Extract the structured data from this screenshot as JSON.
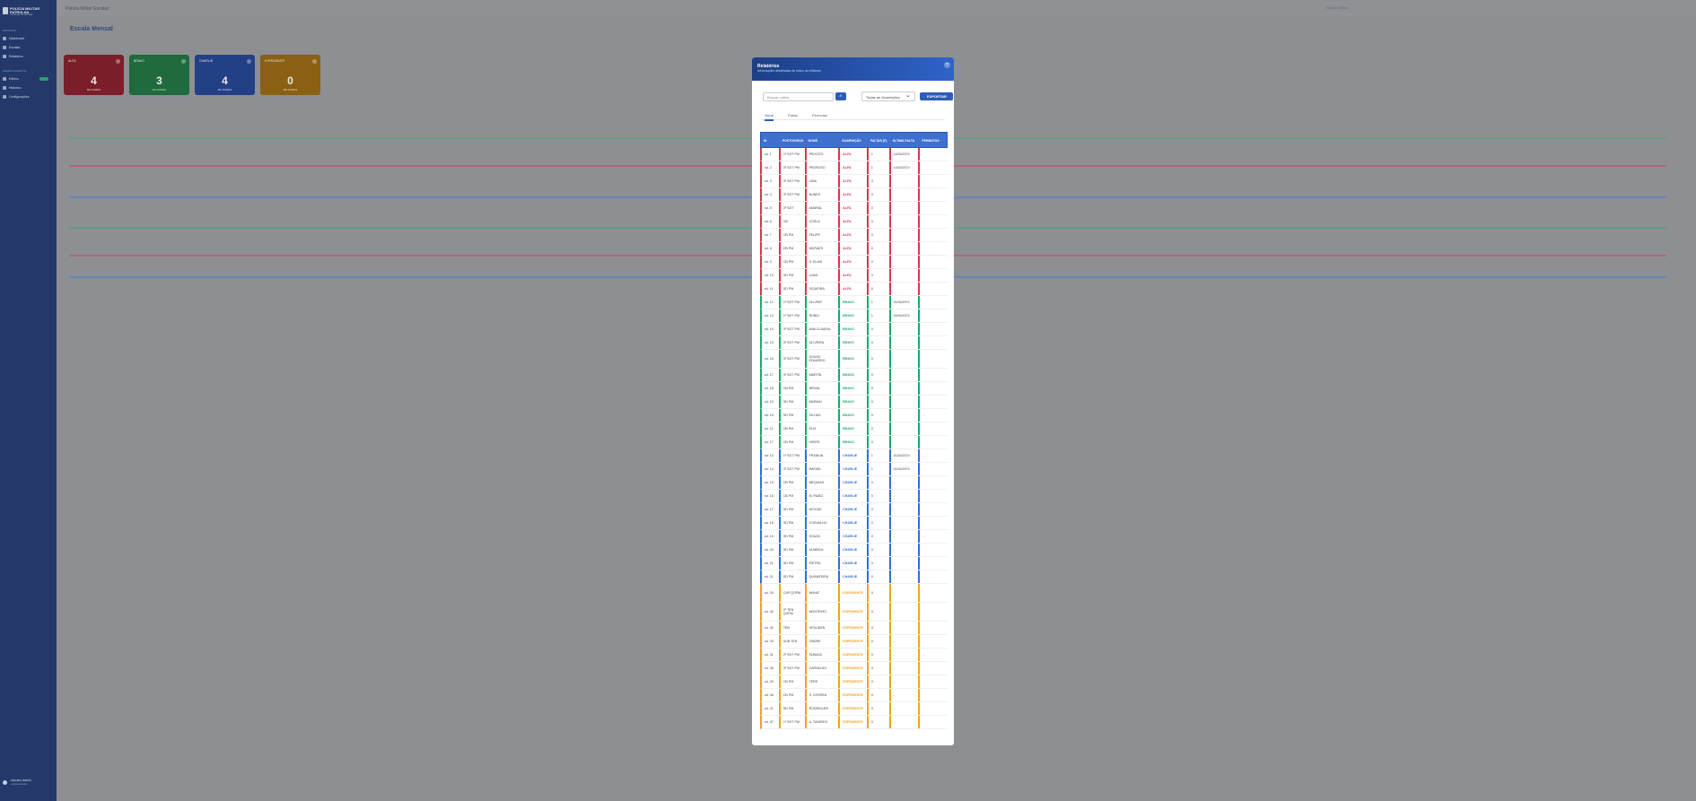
{
  "app": {
    "brand": "POLÍCIA MILITAR",
    "brand_line2": "PATRULHA",
    "subtitle": "Controle de Escala"
  },
  "sidebar": {
    "section_main": "PRINCIPAL",
    "section_cfg": "GERENCIAMENTO",
    "items": [
      {
        "label": "Dashboard"
      },
      {
        "label": "Escalas"
      },
      {
        "label": "Relatórios"
      },
      {
        "label": "Efetivo"
      },
      {
        "label": "Histórico"
      },
      {
        "label": "Configurações"
      }
    ],
    "user_name": "Usuário Admin",
    "user_role": "Administrador"
  },
  "topbar": {
    "title": "Polícia Militar Escalas",
    "search_placeholder": "Buscar militar..."
  },
  "page": {
    "title": "Escala Mensal"
  },
  "cards": [
    {
      "label": "ALFA",
      "value": "4",
      "sub": "MILITARES",
      "color": "#7a1f29"
    },
    {
      "label": "BRAVO",
      "value": "3",
      "sub": "MILITARES",
      "color": "#1f6b3e"
    },
    {
      "label": "CHARLIE",
      "value": "4",
      "sub": "MILITARES",
      "color": "#233f86"
    },
    {
      "label": "EXPEDIENTE",
      "value": "0",
      "sub": "MILITARES",
      "color": "#8a6012"
    }
  ],
  "calendar_lines": [
    "#c9495a",
    "#4c7bd0",
    "#46a873",
    "#c9495a",
    "#4c7bd0",
    "#46a873"
  ],
  "modal": {
    "title": "Relatórios",
    "subtitle": "Informações detalhadas de todos os militares",
    "close": "×",
    "search_placeholder": "Buscar militar...",
    "search_icon": "search-icon",
    "filter_value": "Todas as Guarnições",
    "export_label": "EXPORTAR",
    "tabs": [
      "Geral",
      "Faltas",
      "Permutas"
    ],
    "columns": [
      "ID",
      "POSTO/GRAD",
      "NOME",
      "GUARNIÇÃO",
      "FALTAS (F)",
      "ÚLTIMA FALTA",
      "PERMUTAS"
    ],
    "rows": [
      {
        "id": "sd. 1",
        "posto": "1º SGT PM",
        "nome": "PEIXOTO",
        "gu": "ALFA",
        "faltas": "1",
        "ultima": "14/04/2074",
        "perm": "",
        "g": "alfa"
      },
      {
        "id": "sd. 2",
        "posto": "3º SGT PM",
        "nome": "PEDROSO",
        "gu": "ALFA",
        "faltas": "1",
        "ultima": "14/04/2074",
        "perm": "",
        "g": "alfa"
      },
      {
        "id": "sd. 3",
        "posto": "3º SGT PM",
        "nome": "LIMA",
        "gu": "ALFA",
        "faltas": "0",
        "ultima": "",
        "perm": "",
        "g": "alfa"
      },
      {
        "id": "sd. 4",
        "posto": "3º SGT PM",
        "nome": "NUNES",
        "gu": "ALFA",
        "faltas": "0",
        "ultima": "",
        "perm": "",
        "g": "alfa"
      },
      {
        "id": "sd. 5",
        "posto": "3º SGT",
        "nome": "AMARAL",
        "gu": "ALFA",
        "faltas": "0",
        "ultima": "",
        "perm": "",
        "g": "alfa"
      },
      {
        "id": "sd. 6",
        "posto": "CB",
        "nome": "COELA",
        "gu": "ALFA",
        "faltas": "0",
        "ultima": "",
        "perm": "",
        "g": "alfa"
      },
      {
        "id": "sd. 7",
        "posto": "CB PM",
        "nome": "FELIPE",
        "gu": "ALFA",
        "faltas": "0",
        "ultima": "",
        "perm": "",
        "g": "alfa"
      },
      {
        "id": "sd. 8",
        "posto": "CB PM",
        "nome": "MORAES",
        "gu": "ALFA",
        "faltas": "0",
        "ultima": "",
        "perm": "",
        "g": "alfa"
      },
      {
        "id": "sd. 9",
        "posto": "CB PM",
        "nome": "S. ELIAS",
        "gu": "ALFA",
        "faltas": "0",
        "ultima": "",
        "perm": "",
        "g": "alfa"
      },
      {
        "id": "sd. 10",
        "posto": "SD PM",
        "nome": "LUAN",
        "gu": "ALFA",
        "faltas": "0",
        "ultima": "",
        "perm": "",
        "g": "alfa"
      },
      {
        "id": "sd. 11",
        "posto": "SD PM",
        "nome": "SIQUEIRA",
        "gu": "ALFA",
        "faltas": "0",
        "ultima": "",
        "perm": "",
        "g": "alfa"
      },
      {
        "id": "sd. 12",
        "posto": "1º SGT PM",
        "nome": "OLIVEIR",
        "gu": "BRAVO",
        "faltas": "1",
        "ultima": "01/04/2074",
        "perm": "",
        "g": "bravo"
      },
      {
        "id": "sd. 13",
        "posto": "1º SGT PM",
        "nome": "RUBIO",
        "gu": "BRAVO",
        "faltas": "1",
        "ultima": "04/04/2074",
        "perm": "",
        "g": "bravo"
      },
      {
        "id": "sd. 14",
        "posto": "3º SGT PM",
        "nome": "ANA CLAUDIA",
        "gu": "BRAVO",
        "faltas": "0",
        "ultima": "",
        "perm": "",
        "g": "bravo"
      },
      {
        "id": "sd. 15",
        "posto": "3º SGT PM",
        "nome": "OLIVEIRA",
        "gu": "BRAVO",
        "faltas": "0",
        "ultima": "",
        "perm": "",
        "g": "bravo"
      },
      {
        "id": "sd. 16",
        "posto": "3º SGT PM",
        "nome": "SOUZA EDUARDO",
        "gu": "BRAVO",
        "faltas": "0",
        "ultima": "",
        "perm": "",
        "g": "bravo",
        "tall": true
      },
      {
        "id": "sd. 17",
        "posto": "3º SGT PM",
        "nome": "MARTÍN",
        "gu": "BRAVO",
        "faltas": "0",
        "ultima": "",
        "perm": "",
        "g": "bravo"
      },
      {
        "id": "sd. 18",
        "posto": "CB PM",
        "nome": "BRIVAL",
        "gu": "BRAVO",
        "faltas": "0",
        "ultima": "",
        "perm": "",
        "g": "bravo"
      },
      {
        "id": "sd. 19",
        "posto": "SD PM",
        "nome": "MARIAN",
        "gu": "BRAVO",
        "faltas": "0",
        "ultima": "",
        "perm": "",
        "g": "bravo"
      },
      {
        "id": "sd. 15",
        "posto": "SD PM",
        "nome": "OELIAS",
        "gu": "BRAVO",
        "faltas": "0",
        "ultima": "",
        "perm": "-",
        "g": "bravo"
      },
      {
        "id": "sd. 11",
        "posto": "CB PM",
        "nome": "ELIS",
        "gu": "BRAVO",
        "faltas": "0",
        "ultima": "",
        "perm": "",
        "g": "bravo"
      },
      {
        "id": "sd. 17",
        "posto": "CB PM",
        "nome": "VIEIRS",
        "gu": "BRAVO",
        "faltas": "0",
        "ultima": "",
        "perm": "",
        "g": "bravo"
      },
      {
        "id": "sd. 13",
        "posto": "1º SGT PM",
        "nome": "FRANKIN",
        "gu": "CHARLIE",
        "faltas": "1",
        "ultima": "01/04/2074",
        "perm": "-",
        "g": "charlie"
      },
      {
        "id": "sd. 14",
        "posto": "3º SGT PM",
        "nome": "RAFAEL",
        "gu": "CHARLIE",
        "faltas": "1",
        "ultima": "01/04/2074",
        "perm": "-",
        "g": "charlie"
      },
      {
        "id": "sd. 15",
        "posto": "CB PM",
        "nome": "MEQUIAS",
        "gu": "CHARLIE",
        "faltas": "0",
        "ultima": "-",
        "perm": "",
        "g": "charlie"
      },
      {
        "id": "sd. 16",
        "posto": "CB PM",
        "nome": "M. PAIÃO",
        "gu": "CHARLIE",
        "faltas": "0",
        "ultima": "-",
        "perm": "",
        "g": "charlie"
      },
      {
        "id": "sd. 17",
        "posto": "SD PM",
        "nome": "DIOGUE",
        "gu": "CHARLIE",
        "faltas": "0",
        "ultima": "-",
        "perm": "",
        "g": "charlie"
      },
      {
        "id": "sd. 18",
        "posto": "SD PM",
        "nome": "CORVALHO",
        "gu": "CHARLIE",
        "faltas": "0",
        "ultima": "-",
        "perm": "",
        "g": "charlie"
      },
      {
        "id": "sd. 19",
        "posto": "SD PM",
        "nome": "SOUZA",
        "gu": "CHARLIE",
        "faltas": "0",
        "ultima": "-",
        "perm": "-",
        "g": "charlie"
      },
      {
        "id": "sd. 20",
        "posto": "SD PM",
        "nome": "ALMEIDA",
        "gu": "CHARLIE",
        "faltas": "0",
        "ultima": "-",
        "perm": "",
        "g": "charlie"
      },
      {
        "id": "sd. 21",
        "posto": "SD PM",
        "nome": "PIETRA",
        "gu": "CHARLIE",
        "faltas": "0",
        "ultima": "-",
        "perm": "",
        "g": "charlie"
      },
      {
        "id": "sd. 31",
        "posto": "SD PM",
        "nome": "QUINATEIRA",
        "gu": "CHARLIE",
        "faltas": "0",
        "ultima": "-",
        "perm": "-",
        "g": "charlie"
      },
      {
        "id": "sd. 30",
        "posto": "CAP QOPM",
        "nome": "MUNIZ",
        "gu": "EXPEDIENTE",
        "faltas": "0",
        "ultima": "-",
        "perm": "",
        "g": "exp",
        "tall": true
      },
      {
        "id": "sd. 40",
        "posto": "2º TEN QOPM",
        "nome": "MONTEIRO",
        "gu": "EXPEDIENTE",
        "faltas": "0",
        "ultima": "-",
        "perm": "",
        "g": "exp",
        "tall": true
      },
      {
        "id": "sd. 30",
        "posto": "TEN",
        "nome": "OFALIDEN",
        "gu": "EXPEDIENTE",
        "faltas": "0",
        "ultima": "-",
        "perm": "",
        "g": "exp"
      },
      {
        "id": "sd. 34",
        "posto": "SUB TEN",
        "nome": "ONDRE",
        "gu": "EXPEDIENTE",
        "faltas": "0",
        "ultima": "-",
        "perm": "",
        "g": "exp"
      },
      {
        "id": "sd. 31",
        "posto": "2º SGT PM",
        "nome": "SUNAYA",
        "gu": "EXPEDIENTE",
        "faltas": "0",
        "ultima": "-",
        "perm": "-",
        "g": "exp"
      },
      {
        "id": "sd. 38",
        "posto": "3º SGT PM",
        "nome": "CARVALHO",
        "gu": "EXPEDIENTE",
        "faltas": "0",
        "ultima": "-",
        "perm": "",
        "g": "exp"
      },
      {
        "id": "sd. 39",
        "posto": "CB PM",
        "nome": "TERE",
        "gu": "EXPEDIENTE",
        "faltas": "0",
        "ultima": "-",
        "perm": "",
        "g": "exp"
      },
      {
        "id": "sd. 38",
        "posto": "CB PM",
        "nome": "S. CORREA",
        "gu": "EXPEDIENTE",
        "faltas": "0",
        "ultima": "-",
        "perm": "",
        "g": "exp"
      },
      {
        "id": "sd. 41",
        "posto": "SD PM",
        "nome": "RODRIGUES",
        "gu": "EXPEDIENTE",
        "faltas": "0",
        "ultima": "-",
        "perm": "",
        "g": "exp"
      },
      {
        "id": "sd. 47",
        "posto": "1º SGT PM",
        "nome": "A. TAVARES",
        "gu": "EXPEDIENTE",
        "faltas": "0",
        "ultima": "-",
        "perm": "",
        "g": "exp"
      }
    ]
  },
  "group_colors": {
    "alfa": "#d6364f",
    "bravo": "#1aa86b",
    "charlie": "#2f6fd6",
    "exp": "#f0a21d"
  }
}
